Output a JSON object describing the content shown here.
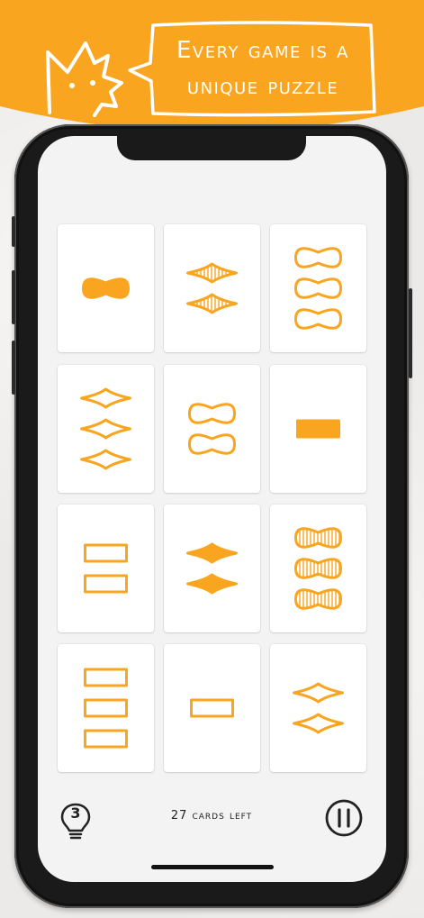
{
  "banner": {
    "line1": "Every game is a",
    "line2": "unique puzzle",
    "bg_color": "#f9a520",
    "mascot_icon": "cat-mascot-icon"
  },
  "accent_color": "#f9a520",
  "cards": [
    {
      "count": 1,
      "shape": "bowtie",
      "fill": "solid"
    },
    {
      "count": 2,
      "shape": "diamond",
      "fill": "striped"
    },
    {
      "count": 3,
      "shape": "bowtie",
      "fill": "outline"
    },
    {
      "count": 3,
      "shape": "diamond",
      "fill": "outline"
    },
    {
      "count": 2,
      "shape": "bowtie",
      "fill": "outline"
    },
    {
      "count": 1,
      "shape": "rectangle",
      "fill": "solid"
    },
    {
      "count": 2,
      "shape": "rectangle",
      "fill": "outline"
    },
    {
      "count": 2,
      "shape": "diamond",
      "fill": "solid"
    },
    {
      "count": 3,
      "shape": "bowtie",
      "fill": "striped"
    },
    {
      "count": 3,
      "shape": "rectangle",
      "fill": "outline"
    },
    {
      "count": 1,
      "shape": "rectangle",
      "fill": "outline"
    },
    {
      "count": 2,
      "shape": "diamond",
      "fill": "outline"
    }
  ],
  "footer": {
    "hints_count": "3",
    "hint_icon": "lightbulb-icon",
    "cards_left_text": "27 cards left",
    "pause_icon": "pause-icon"
  }
}
